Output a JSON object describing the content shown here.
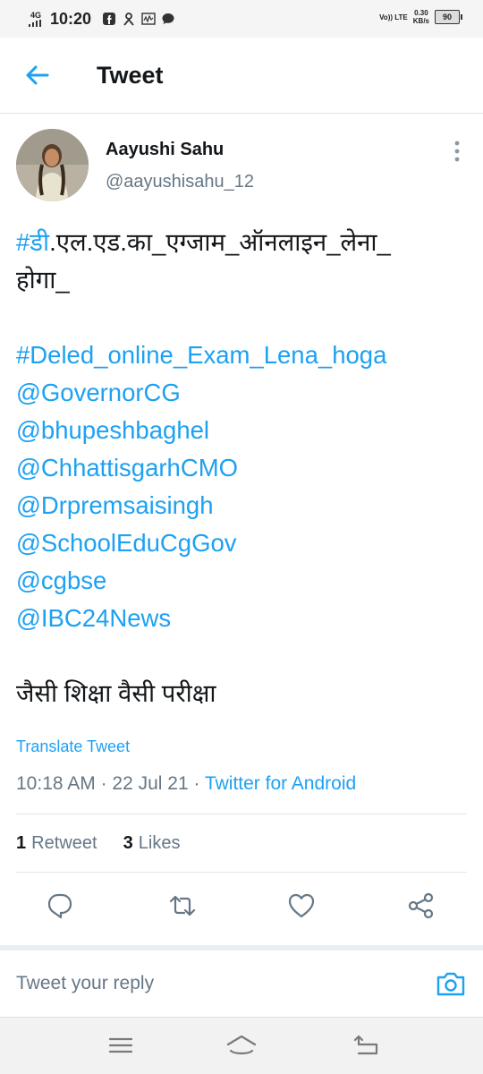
{
  "status_bar": {
    "network": "4G",
    "time": "10:20",
    "volte": "Vo)) LTE",
    "speed": "0.30",
    "speed_unit": "KB/s",
    "battery": "90"
  },
  "header": {
    "title": "Tweet"
  },
  "tweet": {
    "author_name": "Aayushi Sahu",
    "author_handle": "@aayushisahu_12",
    "lines": {
      "l1": "#डी.एल.एड.का_एग्जाम_ऑनलाइन_लेना_",
      "l2": "होगा_",
      "l3": "#Deled_online_Exam_Lena_hoga",
      "l4": "@GovernorCG",
      "l5": "@bhupeshbaghel",
      "l6": "@ChhattisgarhCMO",
      "l7": "@Drpremsaisingh",
      "l8": "@SchoolEduCgGov",
      "l9": "@cgbse",
      "l10": "@IBC24News",
      "l11": "जैसी शिक्षा वैसी परीक्षा"
    },
    "translate_label": "Translate Tweet",
    "time": "10:18 AM",
    "date": "22 Jul 21",
    "client": "Twitter for Android",
    "retweet_count": "1",
    "retweet_label": "Retweet",
    "like_count": "3",
    "like_label": "Likes"
  },
  "reply": {
    "placeholder": "Tweet your reply"
  },
  "colors": {
    "accent": "#1da1f2",
    "muted": "#657786",
    "text": "#14171a"
  },
  "icons": [
    "back-arrow-icon",
    "more-vertical-icon",
    "reply-icon",
    "retweet-icon",
    "like-icon",
    "share-icon",
    "camera-icon",
    "menu-icon",
    "home-icon",
    "back-icon"
  ]
}
